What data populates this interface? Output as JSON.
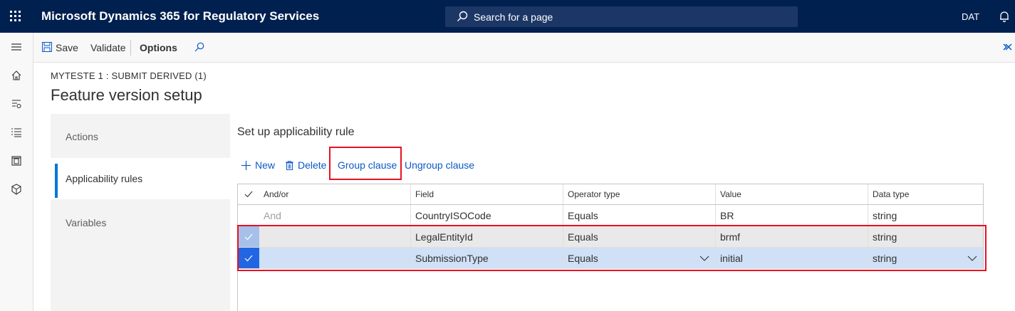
{
  "topbar": {
    "app_title": "Microsoft Dynamics 365 for Regulatory Services",
    "search_placeholder": "Search for a page",
    "company": "DAT"
  },
  "actionpane": {
    "save": "Save",
    "validate": "Validate",
    "options": "Options"
  },
  "page": {
    "caption": "MYTESTE 1 : SUBMIT DERIVED (1)",
    "title": "Feature version setup"
  },
  "tabs": [
    {
      "label": "Actions"
    },
    {
      "label": "Applicability rules"
    },
    {
      "label": "Variables"
    }
  ],
  "section": {
    "title": "Set up applicability rule",
    "toolbar": {
      "new": "New",
      "delete": "Delete",
      "group_clause": "Group clause",
      "ungroup_clause": "Ungroup clause"
    }
  },
  "grid": {
    "columns": [
      "And/or",
      "Field",
      "Operator type",
      "Value",
      "Data type"
    ],
    "rows": [
      {
        "andor": "And",
        "field": "CountryISOCode",
        "operator": "Equals",
        "value": "BR",
        "datatype": "string",
        "selected": false
      },
      {
        "andor": "",
        "field": "LegalEntityId",
        "operator": "Equals",
        "value": "brmf",
        "datatype": "string",
        "selected": true
      },
      {
        "andor": "",
        "field": "SubmissionType",
        "operator": "Equals",
        "value": "initial",
        "datatype": "string",
        "selected": true
      }
    ]
  },
  "colors": {
    "nav_bar": "#002050",
    "accent": "#0078d4",
    "link": "#0b59c7",
    "highlight_box": "#e81123"
  }
}
